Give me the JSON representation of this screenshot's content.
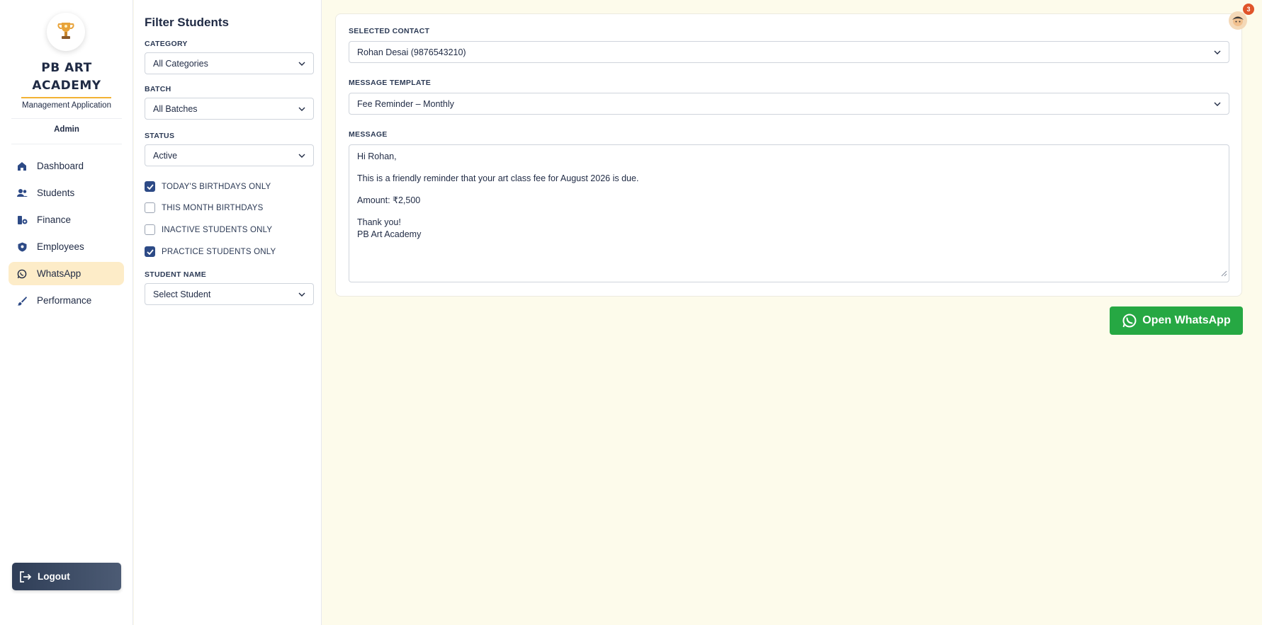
{
  "sidebar": {
    "brand_line1": "PB ART",
    "brand_line2": "ACADEMY",
    "tagline": "Management Application",
    "role": "Admin",
    "nav": [
      {
        "label": "Dashboard",
        "icon": "home-icon"
      },
      {
        "label": "Students",
        "icon": "users-icon"
      },
      {
        "label": "Finance",
        "icon": "finance-icon"
      },
      {
        "label": "Employees",
        "icon": "shield-icon"
      },
      {
        "label": "WhatsApp",
        "icon": "whatsapp-icon",
        "active": true
      },
      {
        "label": "Performance",
        "icon": "brush-icon"
      }
    ],
    "logout_label": "Logout"
  },
  "filters": {
    "title": "Filter Students",
    "category_label": "CATEGORY",
    "category_value": "All Categories",
    "batch_label": "BATCH",
    "batch_value": "All Batches",
    "status_label": "STATUS",
    "status_value": "Active",
    "checkboxes": [
      {
        "label": "TODAY'S BIRTHDAYS ONLY",
        "checked": true
      },
      {
        "label": "THIS MONTH BIRTHDAYS",
        "checked": false
      },
      {
        "label": "INACTIVE STUDENTS ONLY",
        "checked": false
      },
      {
        "label": "PRACTICE STUDENTS ONLY",
        "checked": true
      }
    ],
    "student_name_label": "STUDENT NAME",
    "student_name_value": "Select Student"
  },
  "main": {
    "contact_label": "SELECTED CONTACT",
    "contact_value": "Rohan Desai (9876543210)",
    "template_label": "MESSAGE TEMPLATE",
    "template_value": "Fee Reminder – Monthly",
    "message_label": "MESSAGE",
    "message_lines": {
      "greeting": "Hi Rohan,",
      "body": "This is a friendly reminder that your art class fee for August 2026 is due.",
      "amount": "Amount: ₹2,500",
      "thanks": "Thank you!",
      "signature": "PB Art Academy"
    },
    "whatsapp_button": "Open WhatsApp"
  },
  "header": {
    "notification_count": "3"
  },
  "colors": {
    "accent": "#f2b233",
    "whatsapp_green": "#26a843",
    "checkbox_blue": "#2d4a86",
    "page_bg": "#fdfbeb"
  }
}
